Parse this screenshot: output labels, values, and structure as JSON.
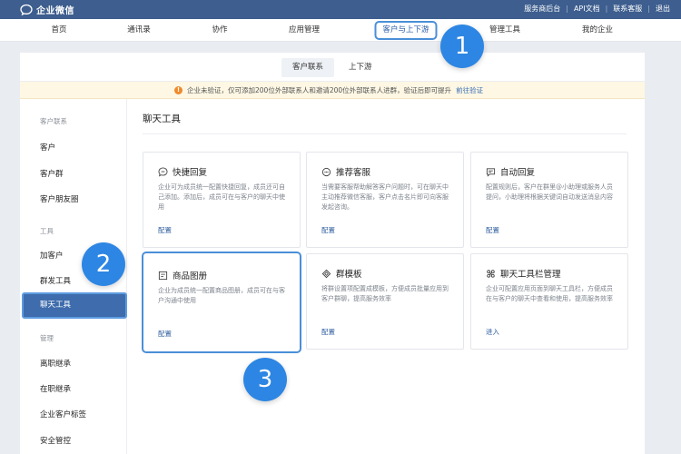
{
  "topbar": {
    "logo_text": "企业微信",
    "links": [
      "服务商后台",
      "API文档",
      "联系客服",
      "退出"
    ]
  },
  "nav": {
    "items": [
      "首页",
      "通讯录",
      "协作",
      "应用管理",
      "客户与上下游",
      "管理工具",
      "我的企业"
    ],
    "active_index": 4
  },
  "subtabs": [
    "客户联系",
    "上下游"
  ],
  "warning": {
    "text": "企业未验证，仅可添加200位外部联系人和邀请200位外部联系人进群，验证后即可提升",
    "link": "前往验证"
  },
  "sidebar": {
    "groups": [
      {
        "label": "客户联系",
        "items": [
          "客户",
          "客户群",
          "客户朋友圈"
        ]
      },
      {
        "label": "工具",
        "items": [
          "加客户",
          "群发工具",
          "聊天工具"
        ]
      },
      {
        "label": "管理",
        "items": [
          "离职继承",
          "在职继承",
          "企业客户标签",
          "安全管控"
        ]
      }
    ],
    "selected": "聊天工具"
  },
  "content": {
    "title": "聊天工具",
    "cards": [
      {
        "icon": "quick-reply-icon",
        "title": "快捷回复",
        "desc": "企业可为成员统一配置快捷回复，成员还可自己添加。添加后，成员可在与客户的聊天中使用",
        "link": "配置"
      },
      {
        "icon": "customer-service-icon",
        "title": "推荐客服",
        "desc": "当需要客服帮助解答客户问题时，可在聊天中主动推荐微信客服，客户点击名片即可向客服发起咨询。",
        "link": "配置"
      },
      {
        "icon": "auto-reply-icon",
        "title": "自动回复",
        "desc": "配置规则后，客户在群里@小助理或服务人员提问，小助理将根据关键词自动发送消息内容",
        "link": "配置"
      },
      {
        "icon": "product-album-icon",
        "title": "商品图册",
        "desc": "企业为成员统一配置商品图册，成员可在与客户沟通中使用",
        "link": "配置"
      },
      {
        "icon": "group-template-icon",
        "title": "群模板",
        "desc": "将群设置项配置成模板，方便成员批量应用到客户群聊，提高服务效率",
        "link": "配置"
      },
      {
        "icon": "toolbar-manage-icon",
        "title": "聊天工具栏管理",
        "desc": "企业可配置应用页面到聊天工具栏，方便成员在与客户的聊天中查看和使用，提高服务效率",
        "link": "进入"
      }
    ]
  },
  "badges": [
    "1",
    "2",
    "3"
  ],
  "colors": {
    "topbar": "#3d5e8e",
    "accent": "#2d86e3",
    "selected": "#3e6cac"
  }
}
